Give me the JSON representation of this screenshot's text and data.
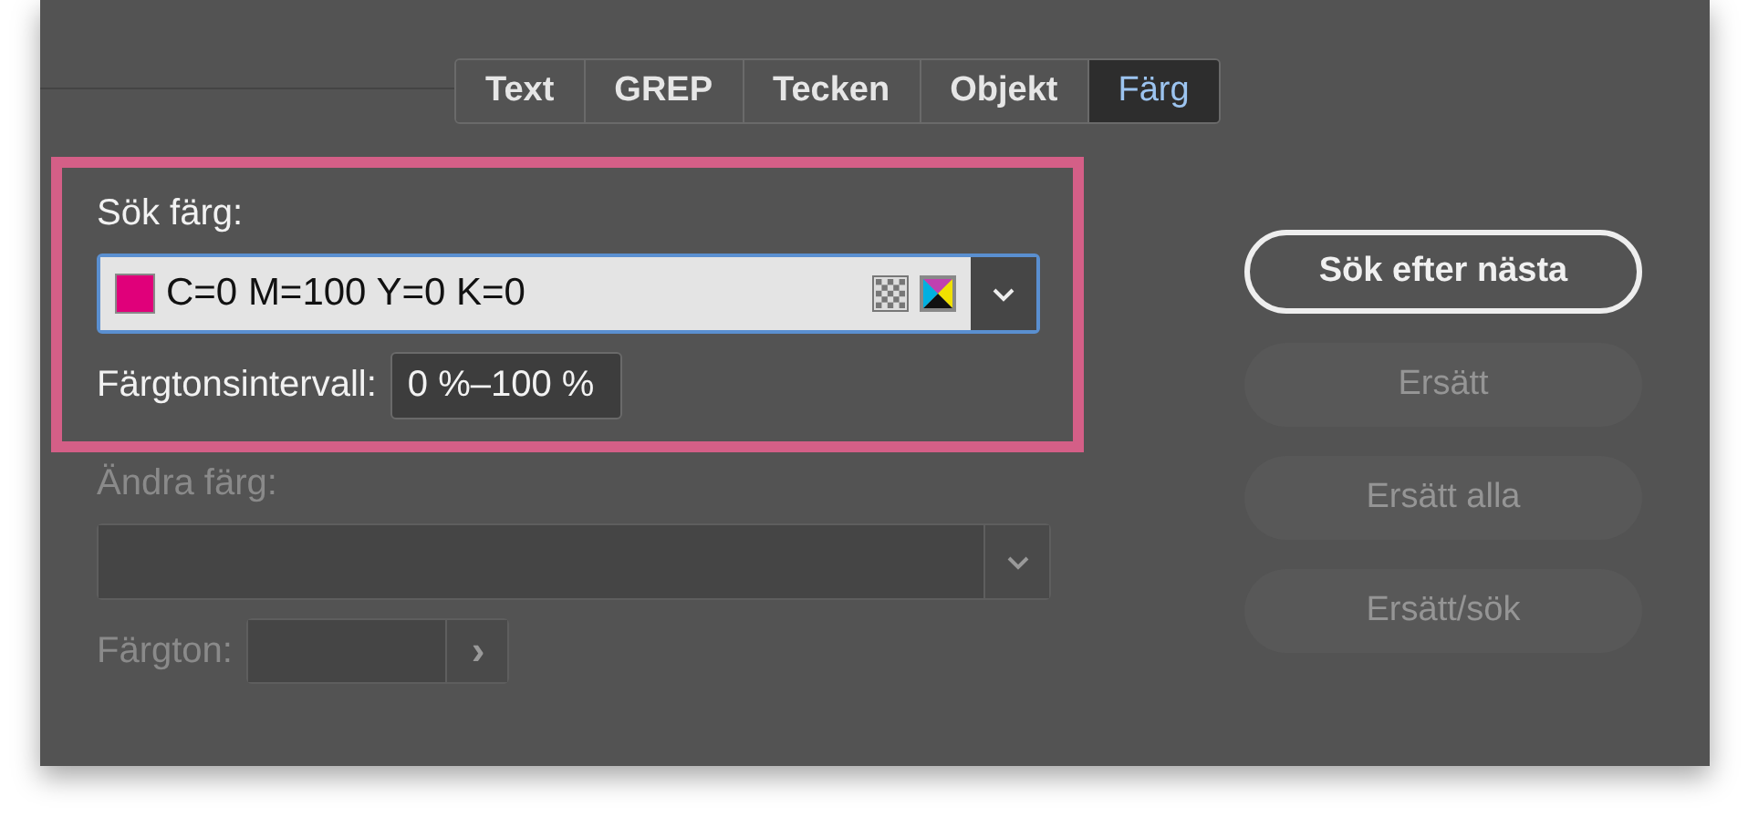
{
  "tabs": [
    {
      "label": "Text",
      "selected": false
    },
    {
      "label": "GREP",
      "selected": false
    },
    {
      "label": "Tecken",
      "selected": false
    },
    {
      "label": "Objekt",
      "selected": false
    },
    {
      "label": "Färg",
      "selected": true
    }
  ],
  "find_color": {
    "label": "Sök färg:",
    "value": "C=0 M=100 Y=0 K=0",
    "tint_label": "Färgtonsintervall:",
    "tint_value": "0 %–100 %"
  },
  "change_color": {
    "label": "Ändra färg:",
    "disabled": true,
    "tint_label": "Färgton:",
    "tint_button": "›"
  },
  "buttons": [
    {
      "label": "Sök efter nästa",
      "disabled": false
    },
    {
      "label": "Ersätt",
      "disabled": true
    },
    {
      "label": "Ersätt alla",
      "disabled": true
    },
    {
      "label": "Ersätt/sök",
      "disabled": true
    }
  ]
}
